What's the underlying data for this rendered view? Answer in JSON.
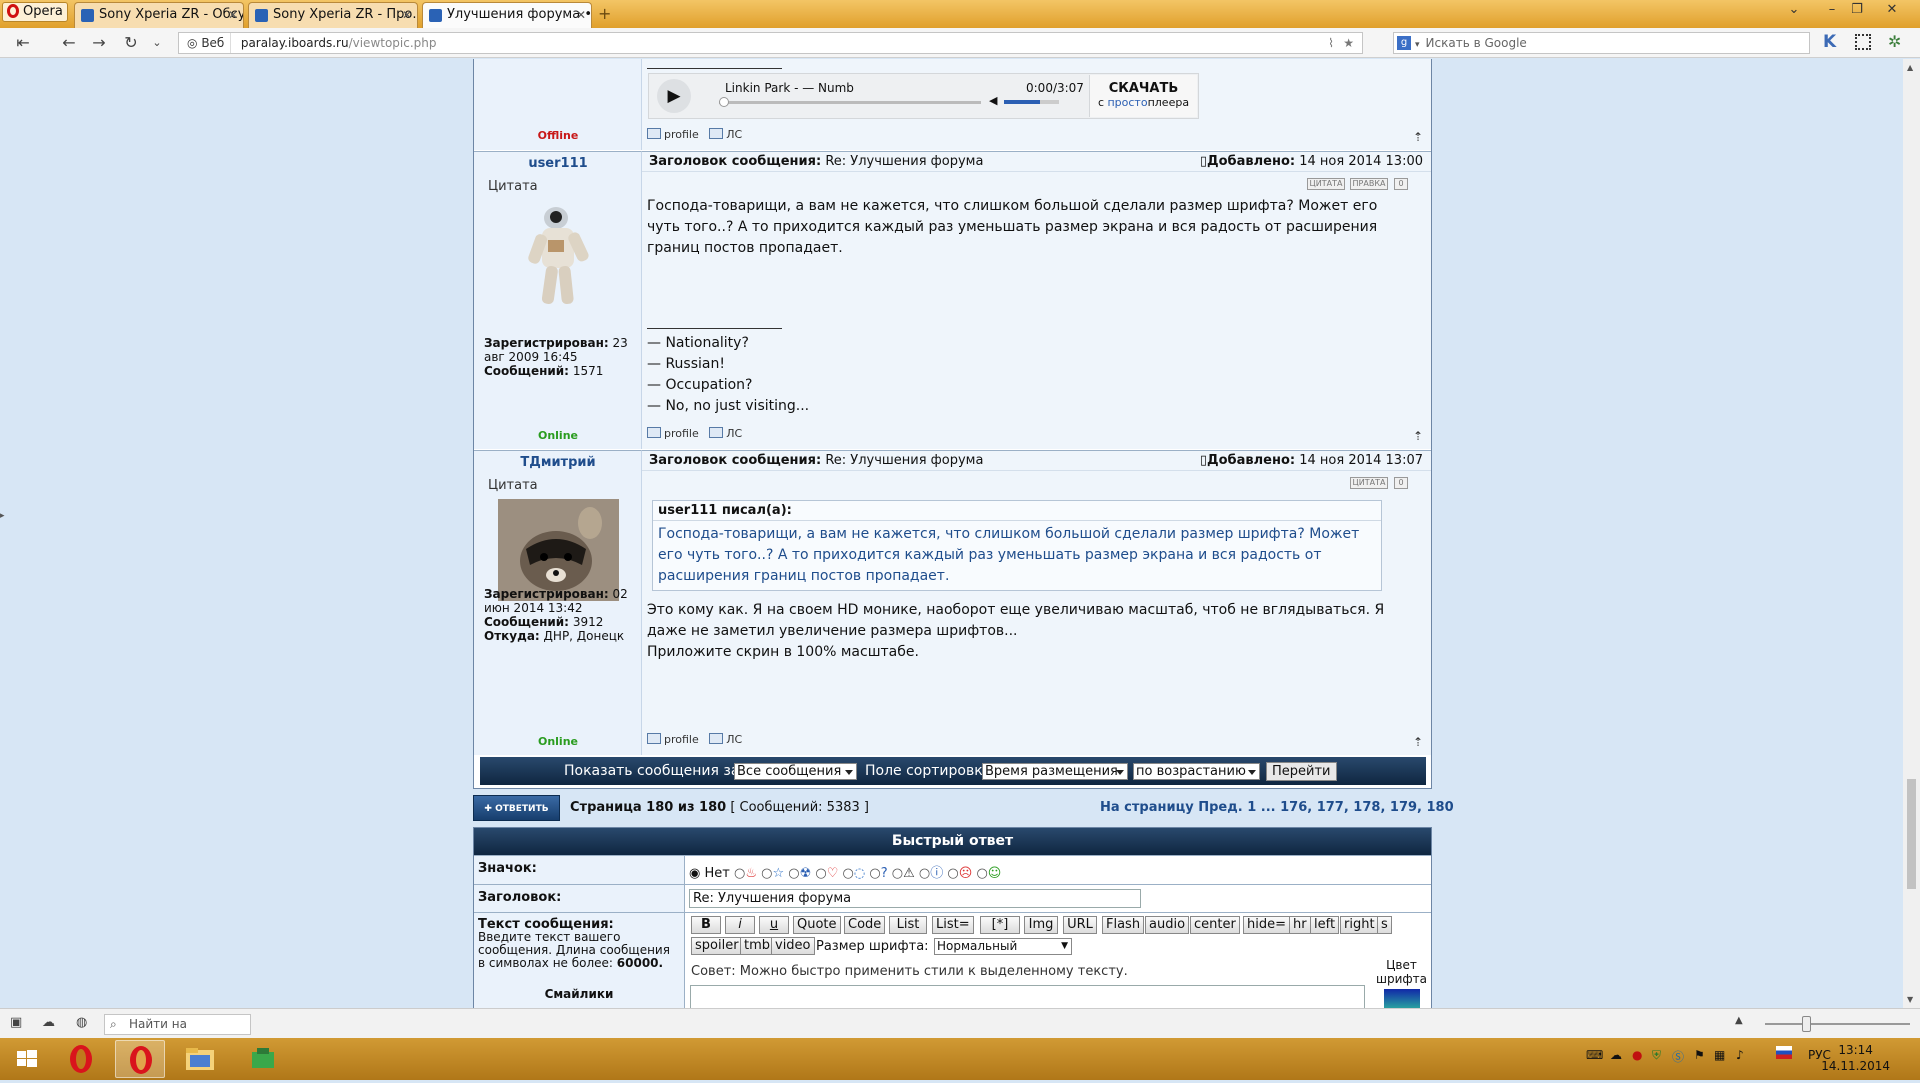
{
  "browser": {
    "menu_label": "Opera",
    "tabs": [
      {
        "title": "Sony Xperia ZR - Обсу..."
      },
      {
        "title": "Sony Xperia ZR - Про..."
      },
      {
        "title": "Улучшения форума • ..."
      }
    ],
    "web_label": "Веб",
    "url_domain": "paralay.iboards.ru",
    "url_path": "/viewtopic.php",
    "search_placeholder": "Искать в Google"
  },
  "player": {
    "track": "Linkin Park - — Numb",
    "time": "0:00/3:07",
    "download": "СКАЧАТЬ",
    "source_prefix": "с ",
    "source_brand": "просто",
    "source_suffix": "плеера"
  },
  "top_post": {
    "status": "Offline",
    "profile": "profile",
    "pm": "ЛС"
  },
  "posts": [
    {
      "username": "user111",
      "rank": "Цитата",
      "subject_label": "Заголовок сообщения:",
      "subject": "Re: Улучшения форума",
      "added_label": "Добавлено:",
      "date": "14 ноя 2014 13:00",
      "btn_quote": "ЦИТАТА",
      "btn_edit": "ПРАВКА",
      "btn_x": "0",
      "text": "Господа-товарищи, а вам не кажется, что слишком большой сделали размер шрифта? Может его чуть того..? А то приходится каждый раз уменьшать размер экрана и вся радость от расширения границ постов пропадает.",
      "sig": [
        "— Nationality?",
        "— Russian!",
        "— Occupation?",
        "— No, no just visiting..."
      ],
      "reg_label": "Зарегистрирован:",
      "reg_value": "23 авг 2009 16:45",
      "msgs_label": "Сообщений:",
      "msgs_value": "1571",
      "status": "Online",
      "profile": "profile",
      "pm": "ЛС"
    },
    {
      "username": "TДмитрий",
      "rank": "Цитата",
      "subject_label": "Заголовок сообщения:",
      "subject": "Re: Улучшения форума",
      "added_label": "Добавлено:",
      "date": "14 ноя 2014 13:07",
      "btn_quote": "ЦИТАТА",
      "btn_x": "0",
      "quote_author": "user111 писал(а):",
      "quote_text": "Господа-товарищи, а вам не кажется, что слишком большой сделали размер шрифта? Может его чуть того..? А то приходится каждый раз уменьшать размер экрана и вся радость от расширения границ постов пропадает.",
      "text1": "Это кому как. Я на своем HD монике, наоборот еще увеличиваю масштаб, чтоб не вглядываться. Я даже не заметил увеличение размера шрифтов...",
      "text2": "Приложите скрин в 100% масштабе.",
      "reg_label": "Зарегистрирован:",
      "reg_value": "02 июн 2014 13:42",
      "msgs_label": "Сообщений:",
      "msgs_value": "3912",
      "from_label": "Откуда:",
      "from_value": "ДНР, Донецк",
      "status": "Online",
      "profile": "profile",
      "pm": "ЛС"
    }
  ],
  "sortbar": {
    "show_label": "Показать сообщения за:",
    "show_value": "Все сообщения",
    "sort_label": "Поле сортировки",
    "sort_value": "Время размещения",
    "order_value": "по возрастанию",
    "go": "Перейти"
  },
  "pagination": {
    "reply": "ОТВЕТИТЬ",
    "page_info": "Страница 180 из 180",
    "count": "[ Сообщений: 5383 ]",
    "nav": "На страницу Пред.  1 ... 176, 177, 178, 179, 180"
  },
  "quick_reply": {
    "title": "Быстрый ответ",
    "icon_label": "Значок:",
    "icon_none": "Нет",
    "subject_label": "Заголовок:",
    "subject_value": "Re: Улучшения форума",
    "text_label": "Текст сообщения:",
    "text_hint1": "Введите текст вашего",
    "text_hint2": "сообщения. Длина сообщения",
    "text_hint3": "в символах не более:",
    "text_limit": "60000.",
    "smilies": "Смайлики",
    "buttons": [
      "B",
      "i",
      "u",
      "Quote",
      "Code",
      "List",
      "List=",
      "[*]",
      "Img",
      "URL",
      "Flash",
      "audio",
      "center",
      "hide=",
      "hr",
      "left",
      "right",
      "s"
    ],
    "buttons2": [
      "spoiler",
      "tmb",
      "video"
    ],
    "fontsize_label": "Размер шрифта:",
    "fontsize_value": "Нормальный",
    "tip": "Совет: Можно быстро применить стили к выделенному тексту.",
    "color_label": "Цвет шрифта"
  },
  "statusbar": {
    "find_placeholder": "Найти на странице"
  },
  "taskbar": {
    "lang": "РУС",
    "time": "13:14",
    "date": "14.11.2014"
  }
}
